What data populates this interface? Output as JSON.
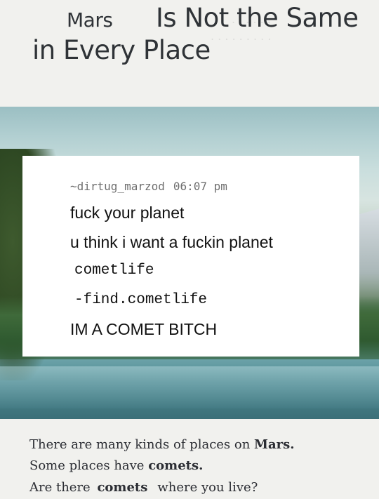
{
  "title": {
    "word_mars": "Mars",
    "rest_line1": "Is Not the Same",
    "line2": "in Every Place"
  },
  "post": {
    "username": "~dirtug_marzod",
    "time": "06:07 pm",
    "lines": [
      "fuck your planet",
      "u think i want a fuckin planet",
      "cometlife",
      "-find.cometlife",
      "IM A COMET BITCH"
    ]
  },
  "caption": {
    "line1_pre": "There are many kinds of places on ",
    "line1_bold": "Mars.",
    "line2_pre": "Some places have ",
    "line2_bold": "comets.",
    "line3_pre": "Are there ",
    "line3_bold": "comets",
    "line3_post": "where you live?"
  }
}
